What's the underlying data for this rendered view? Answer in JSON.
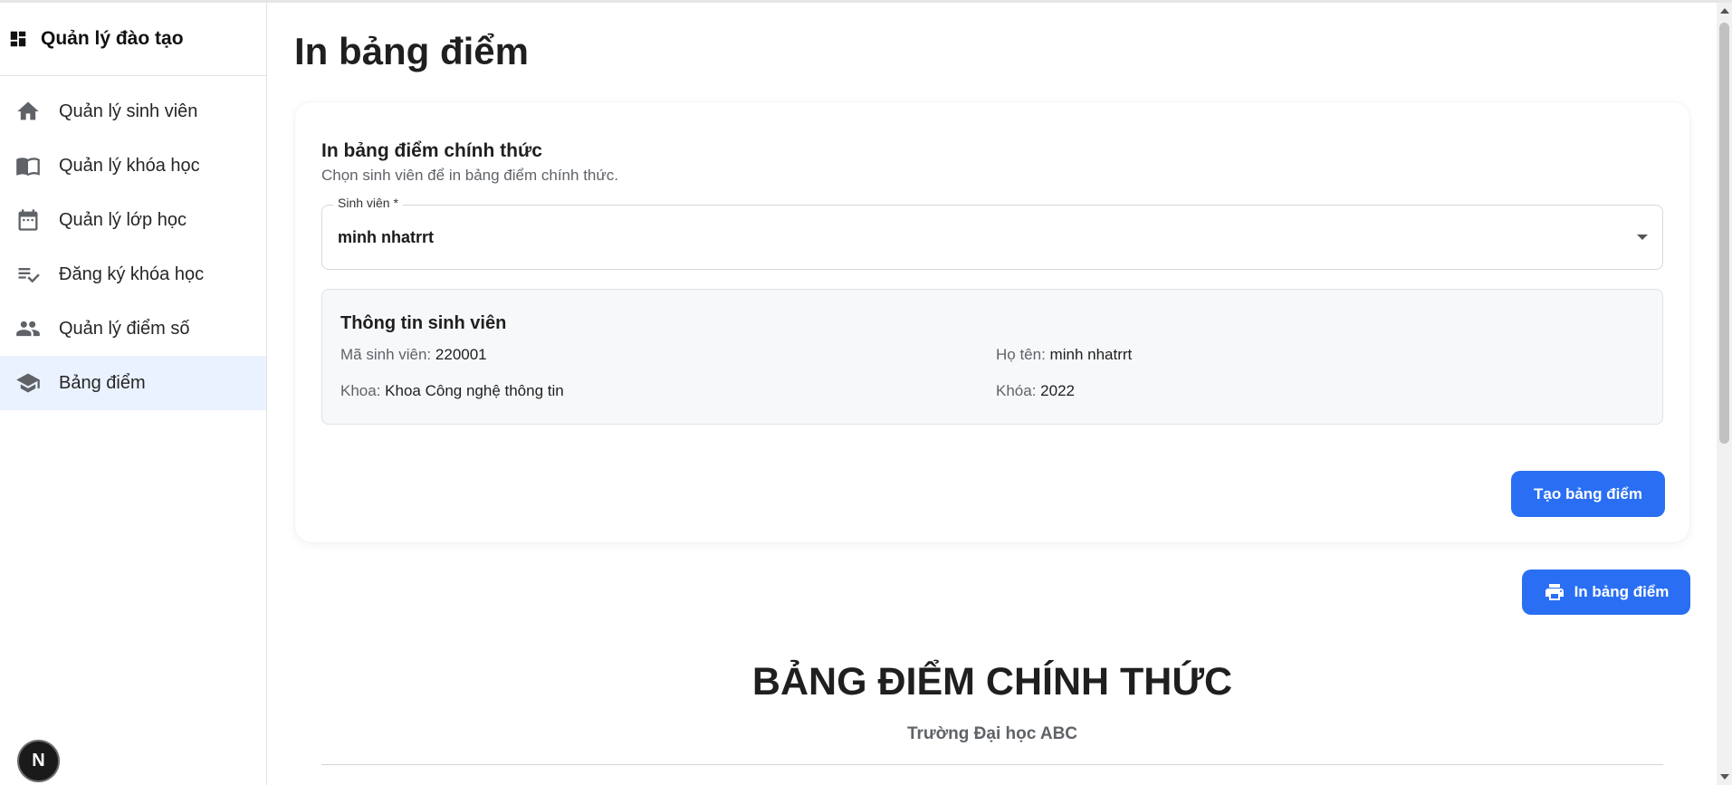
{
  "app": {
    "title": "Quản lý đào tạo"
  },
  "sidebar": {
    "items": [
      {
        "label": "Quản lý sinh viên",
        "icon": "home-icon",
        "active": false
      },
      {
        "label": "Quản lý khóa học",
        "icon": "book-icon",
        "active": false
      },
      {
        "label": "Quản lý lớp học",
        "icon": "calendar-icon",
        "active": false
      },
      {
        "label": "Đăng ký khóa học",
        "icon": "checklist-icon",
        "active": false
      },
      {
        "label": "Quản lý điểm số",
        "icon": "people-icon",
        "active": false
      },
      {
        "label": "Bảng điểm",
        "icon": "school-icon",
        "active": true
      }
    ]
  },
  "badge": {
    "letter": "N"
  },
  "page": {
    "title": "In bảng điểm"
  },
  "card": {
    "title": "In bảng điểm chính thức",
    "subtitle": "Chọn sinh viên để in bảng điểm chính thức.",
    "select": {
      "label": "Sinh viên *",
      "value": "minh nhatrrt"
    },
    "info": {
      "title": "Thông tin sinh viên",
      "student_id_label": "Mã sinh viên:",
      "student_id": "220001",
      "name_label": "Họ tên:",
      "name": "minh nhatrrt",
      "faculty_label": "Khoa:",
      "faculty": "Khoa Công nghệ thông tin",
      "cohort_label": "Khóa:",
      "cohort": "2022"
    },
    "create_button": "Tạo bảng điểm"
  },
  "print_button": "In bảng điểm",
  "report": {
    "title": "BẢNG ĐIỂM CHÍNH THỨC",
    "school": "Trường Đại học ABC"
  },
  "colors": {
    "accent": "#2a6ff3",
    "active_bg": "#eaf2ff"
  }
}
